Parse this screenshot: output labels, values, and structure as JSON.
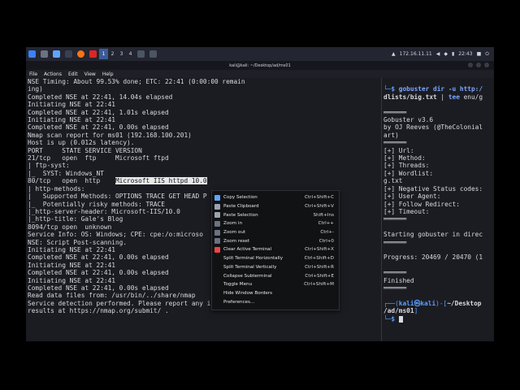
{
  "taskbar": {
    "workspaces": [
      "1",
      "2",
      "3",
      "4"
    ],
    "ip": "172.16.11.11",
    "clock": "22:43"
  },
  "window": {
    "title": "kali@kali: ~/Desktop/ad/ms01"
  },
  "menubar": [
    "File",
    "Actions",
    "Edit",
    "View",
    "Help"
  ],
  "left_lines": [
    "NSE Timing: About 99.53% done; ETC: 22:41 (0:00:00 remain",
    "ing)",
    "Completed NSE at 22:41, 14.04s elapsed",
    "Initiating NSE at 22:41",
    "Completed NSE at 22:41, 1.01s elapsed",
    "Initiating NSE at 22:41",
    "Completed NSE at 22:41, 0.00s elapsed",
    "Nmap scan report for ms01 (192.168.100.201)",
    "Host is up (0.012s latency).",
    "",
    "PORT     STATE SERVICE VERSION",
    "21/tcp   open  ftp     Microsoft ftpd",
    "| ftp-syst:",
    "|_  SYST: Windows_NT",
    "80/tcp   open  http    ",
    "| http-methods:",
    "|   Supported Methods: OPTIONS TRACE GET HEAD P",
    "|_  Potentially risky methods: TRACE",
    "|_http-server-header: Microsoft-IIS/10.0",
    "|_http-title: Gale's Blog",
    "8094/tcp open  unknown",
    "Service Info: OS: Windows; CPE: cpe:/o:microso",
    "",
    "NSE: Script Post-scanning.",
    "Initiating NSE at 22:41",
    "Completed NSE at 22:41, 0.00s elapsed",
    "Initiating NSE at 22:41",
    "Completed NSE at 22:41, 0.00s elapsed",
    "Initiating NSE at 22:41",
    "Completed NSE at 22:41, 0.00s elapsed",
    "Read data files from: /usr/bin/../share/nmap",
    "Service detection performed. Please report any incorrect",
    "results at https://nmap.org/submit/ ."
  ],
  "highlight_text": "Microsoft IIS httpd 10.0",
  "right": {
    "cmd_line1": "gobuster dir -u http:/",
    "cmd_line2a": "dlists/big.txt",
    "cmd_line2b": " | ",
    "cmd_line2c": "tee",
    "cmd_line2d": " enu/g",
    "sep": "══════",
    "banner1": "Gobuster v3.6",
    "banner2": "by OJ Reeves (@TheColonial",
    "banner3": "art)",
    "params": [
      "[+] Url:",
      "[+] Method:",
      "[+] Threads:",
      "[+] Wordlist:",
      "g.txt",
      "[+] Negative Status codes:",
      "[+] User Agent:",
      "[+] Follow Redirect:",
      "[+] Timeout:"
    ],
    "starting": "Starting gobuster in direc",
    "progress": "Progress: 20469 / 20470 (1",
    "finished": "Finished",
    "prompt_user": "kali",
    "prompt_at": "㉿",
    "prompt_host": "kali",
    "prompt_path": "~/Desktop",
    "prompt_path2": "/ad/ms01",
    "prompt_symbol": "$"
  },
  "context_menu": [
    {
      "label": "Copy Selection",
      "shortcut": "Ctrl+Shift+C",
      "icon": "copy-icon"
    },
    {
      "label": "Paste Clipboard",
      "shortcut": "Ctrl+Shift+V",
      "icon": "paste-icon"
    },
    {
      "label": "Paste Selection",
      "shortcut": "Shift+Ins",
      "icon": "paste-selection-icon"
    },
    {
      "label": "Zoom in",
      "shortcut": "Ctrl++",
      "icon": "zoom-in-icon"
    },
    {
      "label": "Zoom out",
      "shortcut": "Ctrl+-",
      "icon": "zoom-out-icon"
    },
    {
      "label": "Zoom reset",
      "shortcut": "Ctrl+0",
      "icon": "zoom-reset-icon"
    },
    {
      "label": "Clear Active Terminal",
      "shortcut": "Ctrl+Shift+X",
      "icon": "clear-icon"
    },
    {
      "label": "Split Terminal Horizontally",
      "shortcut": "Ctrl+Shift+D",
      "icon": ""
    },
    {
      "label": "Split Terminal Vertically",
      "shortcut": "Ctrl+Shift+R",
      "icon": ""
    },
    {
      "label": "Collapse Subterminal",
      "shortcut": "Ctrl+Shift+E",
      "icon": ""
    },
    {
      "label": "Toggle Menu",
      "shortcut": "Ctrl+Shift+M",
      "icon": ""
    },
    {
      "label": "Hide Window Borders",
      "shortcut": "",
      "icon": ""
    },
    {
      "label": "Preferences...",
      "shortcut": "",
      "icon": ""
    }
  ],
  "colors": {
    "accent": "#3b5b99",
    "prompt_blue": "#5aa0ff",
    "bg": "#1b1c22"
  }
}
